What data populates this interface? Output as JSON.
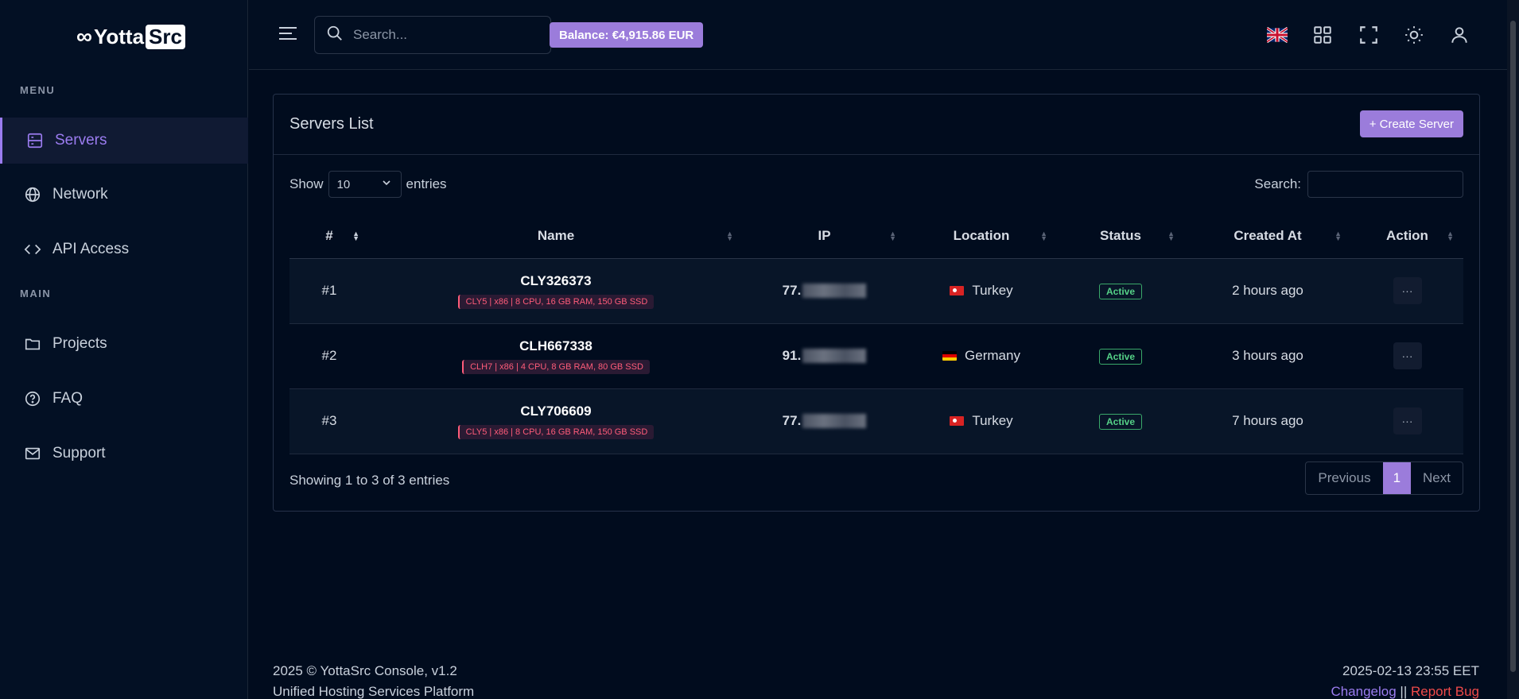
{
  "brand": {
    "name_part1": "Yotta",
    "name_part2": "Src"
  },
  "sidebar": {
    "menu_label": "MENU",
    "main_label": "MAIN",
    "items": [
      {
        "label": "Servers",
        "icon": "server-icon"
      },
      {
        "label": "Network",
        "icon": "globe-icon"
      },
      {
        "label": "API Access",
        "icon": "code-icon"
      },
      {
        "label": "Projects",
        "icon": "folder-icon"
      },
      {
        "label": "FAQ",
        "icon": "help-circle-icon"
      },
      {
        "label": "Support",
        "icon": "mail-icon"
      }
    ]
  },
  "header": {
    "search_placeholder": "Search...",
    "balance": "Balance: €4,915.86 EUR"
  },
  "card": {
    "title": "Servers List",
    "create_label": "+ Create Server",
    "show_label": "Show",
    "entries_value": "10",
    "entries_label": "entries",
    "search_label": "Search:"
  },
  "table": {
    "columns": [
      "#",
      "Name",
      "IP",
      "Location",
      "Status",
      "Created At",
      "Action"
    ],
    "rows": [
      {
        "num": "#1",
        "name": "CLY326373",
        "spec": "CLY5 | x86 | 8 CPU, 16 GB RAM, 150 GB SSD",
        "ip": "77.",
        "location": "Turkey",
        "status": "Active",
        "created": "2 hours ago",
        "action": "···"
      },
      {
        "num": "#2",
        "name": "CLH667338",
        "spec": "CLH7 | x86 | 4 CPU, 8 GB RAM, 80 GB SSD",
        "ip": "91.",
        "location": "Germany",
        "status": "Active",
        "created": "3 hours ago",
        "action": "···"
      },
      {
        "num": "#3",
        "name": "CLY706609",
        "spec": "CLY5 | x86 | 8 CPU, 16 GB RAM, 150 GB SSD",
        "ip": "77.",
        "location": "Turkey",
        "status": "Active",
        "created": "7 hours ago",
        "action": "···"
      }
    ]
  },
  "pagination": {
    "showing": "Showing 1 to 3 of 3 entries",
    "previous": "Previous",
    "current": "1",
    "next": "Next"
  },
  "footer": {
    "copyright": "2025 © YottaSrc Console, v1.2",
    "tagline": "Unified Hosting Services Platform",
    "datetime": "2025-02-13 23:55 EET",
    "changelog": "Changelog",
    "separator": "||",
    "report_bug": "Report Bug"
  },
  "colors": {
    "accent": "#9b7cdb",
    "background": "#010c1e",
    "active_status": "#55d187",
    "spec_text": "#ff5c7a"
  }
}
